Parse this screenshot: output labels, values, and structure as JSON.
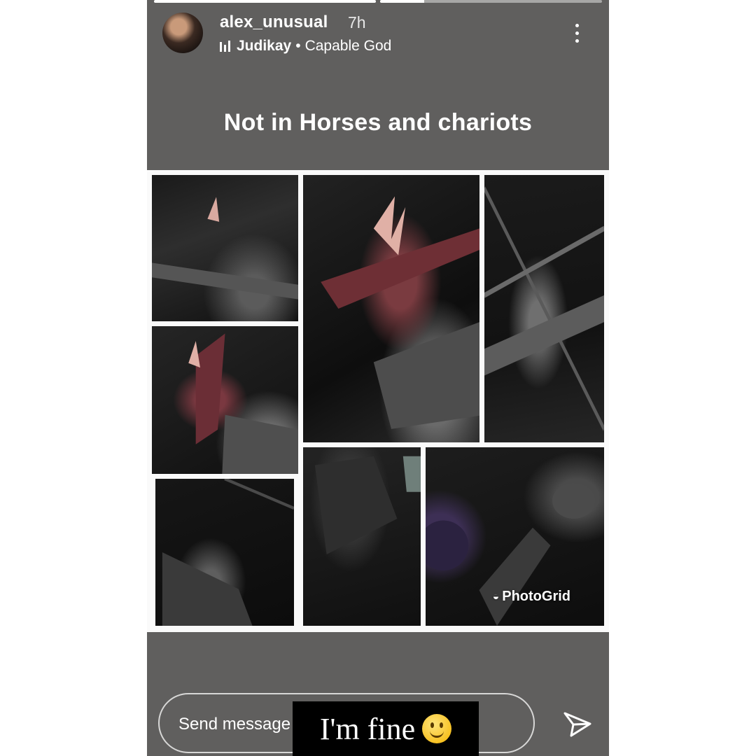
{
  "story": {
    "username": "alex_unusual",
    "time_ago": "7h",
    "music": {
      "artist": "Judikay",
      "separator": "•",
      "song": "Capable God"
    },
    "progress": [
      1.0,
      0.2
    ]
  },
  "caption": "Not in Horses and chariots",
  "collage": {
    "watermark": "PhotoGrid"
  },
  "composer": {
    "placeholder": "Send message"
  },
  "sticker": {
    "text": "I'm fine"
  },
  "colors": {
    "story_background": "#605f5e",
    "collage_background": "#fafafa",
    "accent_red": "#7a3b40"
  },
  "icons": [
    "avatar",
    "music-bars-icon",
    "more-options-icon",
    "photogrid-logo-icon",
    "smiley-emoji-icon",
    "send-icon"
  ]
}
